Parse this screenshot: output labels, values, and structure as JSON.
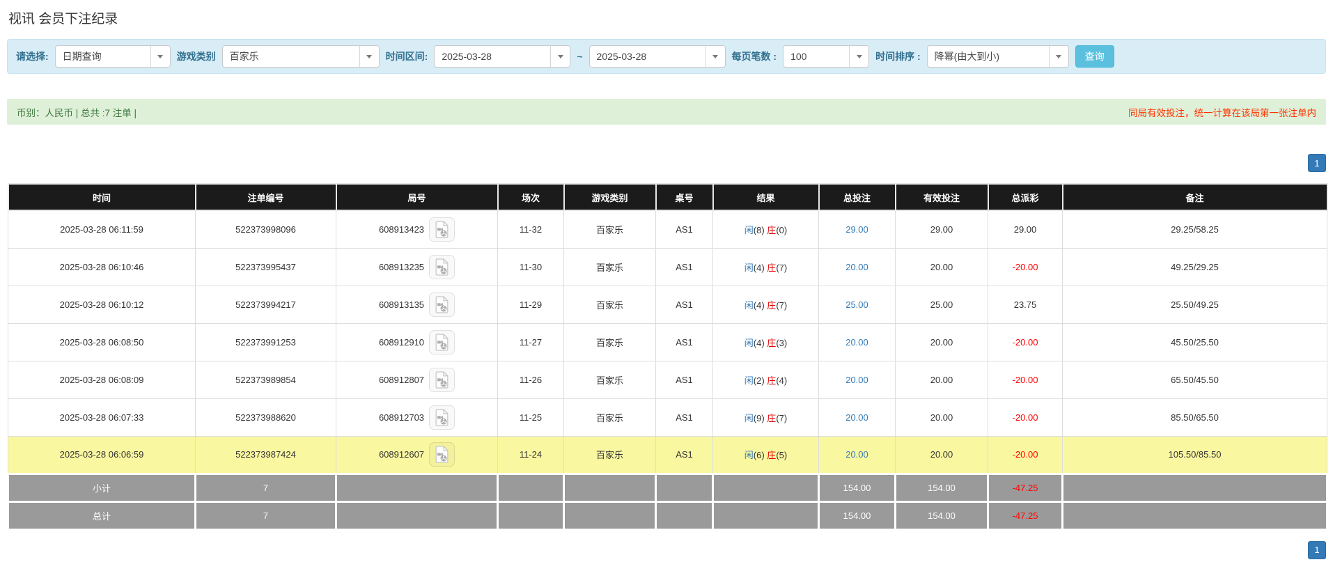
{
  "page": {
    "title": "视讯 会员下注纪录"
  },
  "filter_bar": {
    "query_type_label": "请选择:",
    "query_type_value": "日期查询",
    "game_category_label": "游戏类别",
    "game_category_value": "百家乐",
    "time_range_label": "时间区间:",
    "time_from": "2025-03-28",
    "time_separator": "~",
    "time_to": "2025-03-28",
    "page_size_label": "每页笔数 :",
    "page_size_value": "100",
    "sort_label": "时间排序 :",
    "sort_value": "降幂(由大到小)",
    "search_button_label": "查询"
  },
  "summary_bar": {
    "currency_total_text": "币别：人民币 | 总共 :7 注单 |",
    "notice_text": "同局有效投注，统一计算在该局第一张注单内"
  },
  "pagination": {
    "current_page": "1"
  },
  "table": {
    "headers": [
      "时间",
      "注单编号",
      "局号",
      "场次",
      "游戏类别",
      "桌号",
      "结果",
      "总投注",
      "有效投注",
      "总派彩",
      "备注"
    ],
    "rows": [
      {
        "time": "2025-03-28 06:11:59",
        "bet_id": "522373998096",
        "round_id": "608913423",
        "session": "11-32",
        "game": "百家乐",
        "table": "AS1",
        "result_player": "闲",
        "result_player_count": "(8)",
        "result_banker": "庄",
        "result_banker_count": "(0)",
        "total_bet": "29.00",
        "valid_bet": "29.00",
        "payout": "29.00",
        "payout_negative": false,
        "remark": "29.25/58.25",
        "highlighted": false
      },
      {
        "time": "2025-03-28 06:10:46",
        "bet_id": "522373995437",
        "round_id": "608913235",
        "session": "11-30",
        "game": "百家乐",
        "table": "AS1",
        "result_player": "闲",
        "result_player_count": "(4)",
        "result_banker": "庄",
        "result_banker_count": "(7)",
        "total_bet": "20.00",
        "valid_bet": "20.00",
        "payout": "-20.00",
        "payout_negative": true,
        "remark": "49.25/29.25",
        "highlighted": false
      },
      {
        "time": "2025-03-28 06:10:12",
        "bet_id": "522373994217",
        "round_id": "608913135",
        "session": "11-29",
        "game": "百家乐",
        "table": "AS1",
        "result_player": "闲",
        "result_player_count": "(4)",
        "result_banker": "庄",
        "result_banker_count": "(7)",
        "total_bet": "25.00",
        "valid_bet": "25.00",
        "payout": "23.75",
        "payout_negative": false,
        "remark": "25.50/49.25",
        "highlighted": false
      },
      {
        "time": "2025-03-28 06:08:50",
        "bet_id": "522373991253",
        "round_id": "608912910",
        "session": "11-27",
        "game": "百家乐",
        "table": "AS1",
        "result_player": "闲",
        "result_player_count": "(4)",
        "result_banker": "庄",
        "result_banker_count": "(3)",
        "total_bet": "20.00",
        "valid_bet": "20.00",
        "payout": "-20.00",
        "payout_negative": true,
        "remark": "45.50/25.50",
        "highlighted": false
      },
      {
        "time": "2025-03-28 06:08:09",
        "bet_id": "522373989854",
        "round_id": "608912807",
        "session": "11-26",
        "game": "百家乐",
        "table": "AS1",
        "result_player": "闲",
        "result_player_count": "(2)",
        "result_banker": "庄",
        "result_banker_count": "(4)",
        "total_bet": "20.00",
        "valid_bet": "20.00",
        "payout": "-20.00",
        "payout_negative": true,
        "remark": "65.50/45.50",
        "highlighted": false
      },
      {
        "time": "2025-03-28 06:07:33",
        "bet_id": "522373988620",
        "round_id": "608912703",
        "session": "11-25",
        "game": "百家乐",
        "table": "AS1",
        "result_player": "闲",
        "result_player_count": "(9)",
        "result_banker": "庄",
        "result_banker_count": "(7)",
        "total_bet": "20.00",
        "valid_bet": "20.00",
        "payout": "-20.00",
        "payout_negative": true,
        "remark": "85.50/65.50",
        "highlighted": false
      },
      {
        "time": "2025-03-28 06:06:59",
        "bet_id": "522373987424",
        "round_id": "608912607",
        "session": "11-24",
        "game": "百家乐",
        "table": "AS1",
        "result_player": "闲",
        "result_player_count": "(6)",
        "result_banker": "庄",
        "result_banker_count": "(5)",
        "total_bet": "20.00",
        "valid_bet": "20.00",
        "payout": "-20.00",
        "payout_negative": true,
        "remark": "105.50/85.50",
        "highlighted": true
      }
    ],
    "summary_rows": [
      {
        "label": "小计",
        "count": "7",
        "total_bet": "154.00",
        "valid_bet": "154.00",
        "payout": "-47.25",
        "payout_negative": true
      },
      {
        "label": "总计",
        "count": "7",
        "total_bet": "154.00",
        "valid_bet": "154.00",
        "payout": "-47.25",
        "payout_negative": true
      }
    ]
  },
  "colors": {
    "filter_bg": "#d9edf7",
    "filter_label": "#31708f",
    "summary_bg": "#dff0d8",
    "summary_text": "#3c763d",
    "notice_red": "#ff3300",
    "header_black": "#1b1b1b",
    "row_highlight_yellow": "#faf7a1",
    "summary_row_gray": "#9a9a9a",
    "player_blue": "#337ab7",
    "banker_red": "#e60000",
    "negative_red": "#ff0000",
    "link_blue": "#337ab7",
    "pagination_blue": "#337ab7",
    "search_button_cyan": "#5bc0de"
  }
}
